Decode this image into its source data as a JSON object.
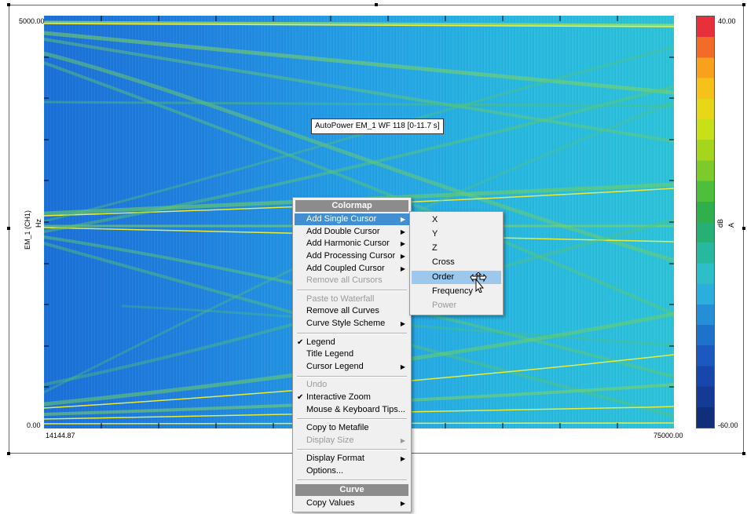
{
  "plot": {
    "y_axis_label": "EM_1 (CH1)",
    "y_axis_unit": "Hz",
    "y_max_label": "5000.00",
    "y_min_label": "0.00",
    "x_min_label": "14144.87",
    "x_max_label": "75000.00",
    "tooltip": "AutoPower EM_1 WF 118 [0-11.7 s]"
  },
  "colorbar": {
    "max_label": "40.00",
    "min_label": "-60.00",
    "unit": "dB",
    "quantity": "A",
    "colors": [
      "#e8303a",
      "#f26b28",
      "#f7a11d",
      "#f6c21a",
      "#e6d816",
      "#c8e018",
      "#a6d61c",
      "#7dcb2a",
      "#4dbf3a",
      "#2fb04c",
      "#26b074",
      "#27b8a0",
      "#2dbfc8",
      "#2aaedc",
      "#248ed6",
      "#1f72cc",
      "#1b58bf",
      "#1746ad",
      "#133a95",
      "#0f2f7a"
    ]
  },
  "context_menu": {
    "header_colormap": "Colormap",
    "add_single_cursor": "Add Single Cursor",
    "add_double_cursor": "Add Double Cursor",
    "add_harmonic_cursor": "Add Harmonic Cursor",
    "add_processing_cursor": "Add Processing Cursor",
    "add_coupled_cursor": "Add Coupled Cursor",
    "remove_all_cursors": "Remove all Cursors",
    "paste_to_waterfall": "Paste to Waterfall",
    "remove_all_curves": "Remove all Curves",
    "curve_style_scheme": "Curve Style Scheme",
    "legend": "Legend",
    "title_legend": "Title Legend",
    "cursor_legend": "Cursor Legend",
    "undo": "Undo",
    "interactive_zoom": "Interactive Zoom",
    "mouse_keyboard_tips": "Mouse & Keyboard Tips...",
    "copy_to_metafile": "Copy to Metafile",
    "display_size": "Display Size",
    "display_format": "Display Format",
    "options": "Options...",
    "header_curve": "Curve",
    "copy_values": "Copy Values",
    "arrow_glyph": "▶",
    "check_glyph": "✔"
  },
  "submenu": {
    "x": "X",
    "y": "Y",
    "z": "Z",
    "cross": "Cross",
    "order": "Order",
    "frequency": "Frequency",
    "power": "Power"
  }
}
